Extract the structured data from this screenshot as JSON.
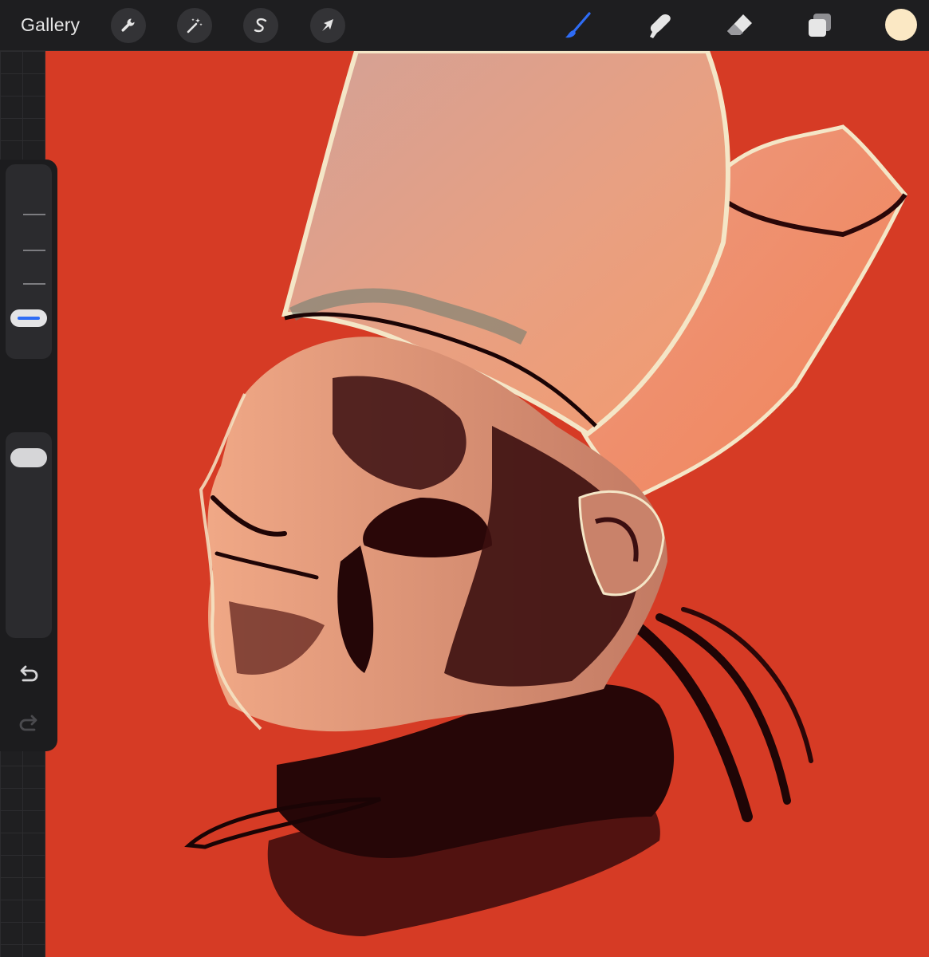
{
  "toolbar": {
    "gallery_label": "Gallery",
    "left_tools": [
      "wrench-icon",
      "magic-wand-icon",
      "selection-s-icon",
      "transform-arrow-icon"
    ],
    "right_tools": [
      "brush-icon",
      "smudge-icon",
      "eraser-icon",
      "layers-icon"
    ],
    "active_tool": "brush-icon",
    "accent_color": "#2e6cf5",
    "current_color": "#fbe8c4"
  },
  "canvas": {
    "background_color": "#d63b25"
  },
  "sidebar": {
    "brush_size_slider": "size",
    "brush_opacity_slider": "opacity",
    "modify_button": "square-modify-icon",
    "undo": "undo-icon",
    "redo": "redo-icon",
    "redo_enabled": false
  }
}
